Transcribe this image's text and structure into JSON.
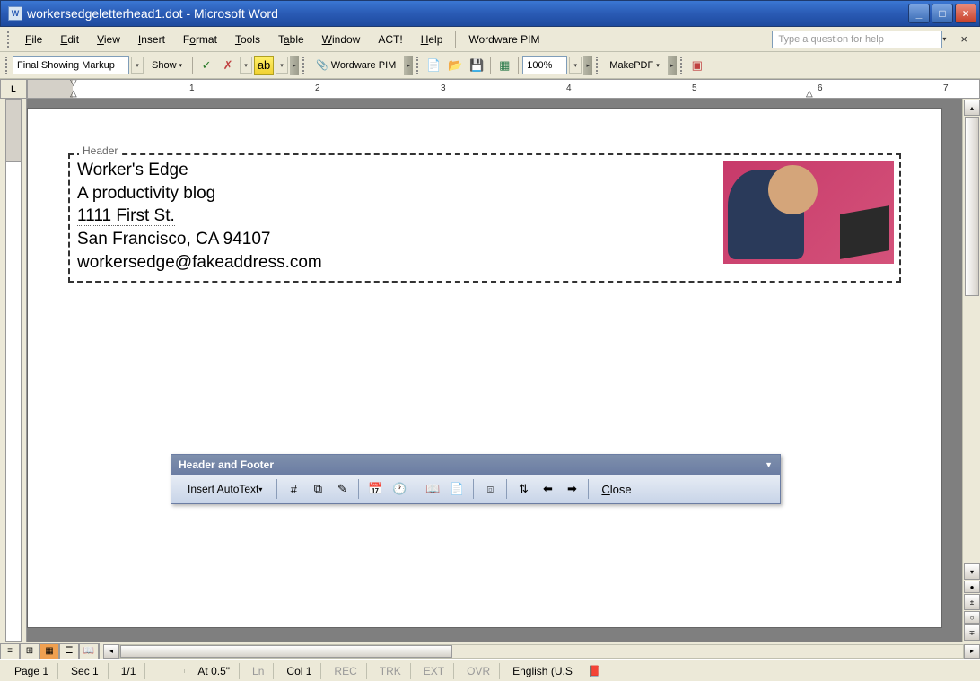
{
  "titlebar": {
    "title": "workersedgeletterhead1.dot - Microsoft Word"
  },
  "menus": {
    "file": "File",
    "edit": "Edit",
    "view": "View",
    "insert": "Insert",
    "format": "Format",
    "tools": "Tools",
    "table": "Table",
    "window": "Window",
    "act": "ACT!",
    "help": "Help",
    "wordware": "Wordware PIM",
    "help_placeholder": "Type a question for help"
  },
  "toolbar": {
    "markup": "Final Showing Markup",
    "show": "Show",
    "wordware_btn": "Wordware PIM",
    "zoom": "100%",
    "makepdf": "MakePDF"
  },
  "document": {
    "header_label": "Header",
    "line1": "Worker's Edge",
    "line2": "A productivity blog",
    "line3": "1111 First St.",
    "line4": "San Francisco, CA 94107",
    "line5": "workersedge@fakeaddress.com"
  },
  "hf_toolbar": {
    "title": "Header and Footer",
    "autotext": "Insert AutoText",
    "close": "Close"
  },
  "statusbar": {
    "page": "Page  1",
    "sec": "Sec 1",
    "pages": "1/1",
    "at": "At 0.5\"",
    "ln": "Ln",
    "col": "Col  1",
    "rec": "REC",
    "trk": "TRK",
    "ext": "EXT",
    "ovr": "OVR",
    "lang": "English (U.S"
  },
  "ruler": {
    "marks": [
      "1",
      "2",
      "3",
      "4",
      "5",
      "6",
      "7"
    ]
  }
}
